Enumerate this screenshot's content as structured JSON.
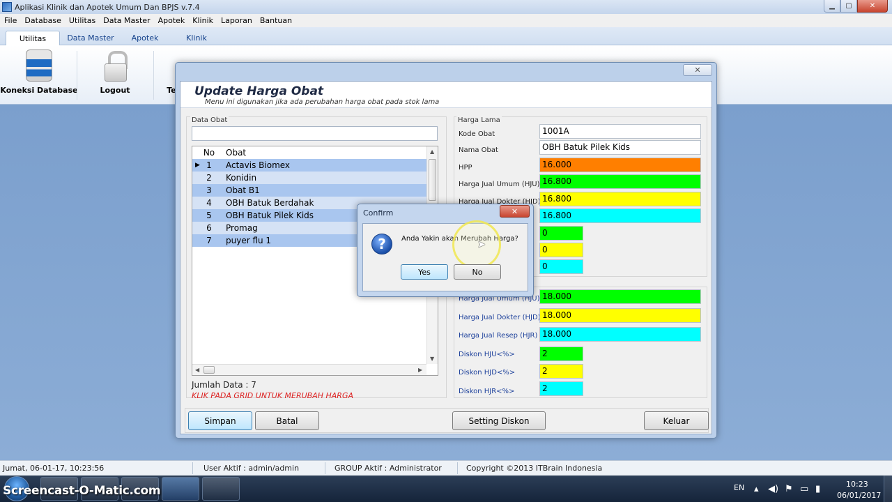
{
  "window": {
    "title": "Aplikasi Klinik dan Apotek Umum Dan BPJS  v.7.4",
    "controls": [
      "▁",
      "▢",
      "✕"
    ]
  },
  "menu": [
    "File",
    "Database",
    "Utilitas",
    "Data Master",
    "Apotek",
    "Klinik",
    "Laporan",
    "Bantuan"
  ],
  "ribbon": {
    "tabs": [
      "Utilitas",
      "Data Master",
      "Apotek",
      "Klinik"
    ],
    "active_tab": "Utilitas",
    "buttons": [
      {
        "label": "Koneksi Database",
        "icon": "database-icon"
      },
      {
        "label": "Logout",
        "icon": "lock-icon"
      },
      {
        "label": "Te",
        "icon": "tool-icon"
      }
    ]
  },
  "dialog": {
    "close_glyph": "✕",
    "title": "Update Harga Obat",
    "subtitle": "Menu ini digunakan jika ada perubahan harga obat pada stok lama",
    "left_panel": {
      "legend": "Data Obat",
      "search_value": "",
      "grid_headers": [
        "No",
        "Obat"
      ],
      "rows": [
        {
          "no": "1",
          "obat": "Actavis Biomex"
        },
        {
          "no": "2",
          "obat": "Konidin"
        },
        {
          "no": "3",
          "obat": "Obat B1"
        },
        {
          "no": "4",
          "obat": "OBH Batuk Berdahak"
        },
        {
          "no": "5",
          "obat": "OBH Batuk Pilek Kids"
        },
        {
          "no": "6",
          "obat": "Promag"
        },
        {
          "no": "7",
          "obat": "puyer flu 1"
        }
      ],
      "selected_row_marker": "▶",
      "count_label": "Jumlah Data : 7",
      "hint": "KLIK PADA GRID UNTUK MERUBAH HARGA"
    },
    "harga_lama": {
      "legend": "Harga Lama",
      "fields": [
        {
          "label": "Kode Obat",
          "value": "1001A",
          "color": "#ffffff"
        },
        {
          "label": "Nama Obat",
          "value": "OBH Batuk Pilek Kids",
          "color": "#ffffff"
        },
        {
          "label": "HPP",
          "value": "16.000",
          "color": "#ff7f00"
        },
        {
          "label": "Harga Jual Umum (HJU)",
          "value": "16.800",
          "color": "#00ff00"
        },
        {
          "label": "Harga Jual Dokter (HJD)",
          "value": "16.800",
          "color": "#ffff00"
        },
        {
          "label": "",
          "value": "16.800",
          "color": "#00ffff"
        },
        {
          "label": "",
          "value": "0",
          "color": "#00ff00"
        },
        {
          "label": "",
          "value": "0",
          "color": "#ffff00"
        },
        {
          "label": "",
          "value": "0",
          "color": "#00ffff"
        }
      ]
    },
    "harga_baru": {
      "fields": [
        {
          "label": "Harga Jual Umum (HJU)",
          "value": "18.000",
          "color": "#00ff00"
        },
        {
          "label": "Harga Jual Dokter (HJD)",
          "value": "18.000",
          "color": "#ffff00"
        },
        {
          "label": "Harga Jual Resep (HJR)",
          "value": "18.000",
          "color": "#00ffff"
        },
        {
          "label": "Diskon HJU<%>",
          "value": "2",
          "color": "#00ff00"
        },
        {
          "label": "Diskon HJD<%>",
          "value": "2",
          "color": "#ffff00"
        },
        {
          "label": "Diskon HJR<%>",
          "value": "2",
          "color": "#00ffff"
        }
      ]
    },
    "buttons": {
      "simpan": "Simpan",
      "batal": "Batal",
      "setting_diskon": "Setting Diskon",
      "keluar": "Keluar"
    }
  },
  "confirm": {
    "title": "Confirm",
    "close_glyph": "✕",
    "icon_glyph": "?",
    "message": "Anda Yakin akan Merubah Harga?",
    "yes": "Yes",
    "no": "No"
  },
  "statusbar": {
    "datetime": "Jumat, 06-01-17, 10:23:56",
    "user": "User Aktif  : admin/admin",
    "group": "GROUP Aktif  : Administrator",
    "copyright": "Copyright ©2013 ITBrain Indonesia"
  },
  "taskbar": {
    "watermark": "Screencast-O-Matic.com",
    "language": "EN",
    "time": "10:23",
    "date": "06/01/2017"
  }
}
